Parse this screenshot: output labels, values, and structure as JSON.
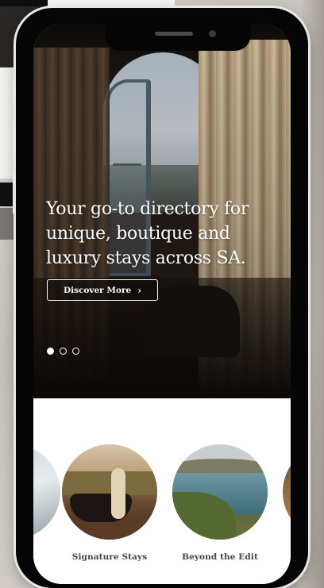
{
  "hero": {
    "headline": "Your go-to directory for unique, boutique and luxury stays across SA.",
    "cta_label": "Discover More",
    "cta_icon": "chevron-right-icon",
    "slides_total": 3,
    "slide_active": 1
  },
  "categories": [
    {
      "label": "",
      "image": "partial-stay-image"
    },
    {
      "label": "Signature Stays",
      "image": "outdoor-bath-vineyard-image"
    },
    {
      "label": "Beyond the Edit",
      "image": "lake-landscape-image"
    },
    {
      "label": "",
      "image": "partial-stay-image"
    }
  ],
  "colors": {
    "hero_text": "#ffffff",
    "category_label": "#444444",
    "phone_frame": "#050505",
    "phone_bezel": "#e9e7e4"
  }
}
